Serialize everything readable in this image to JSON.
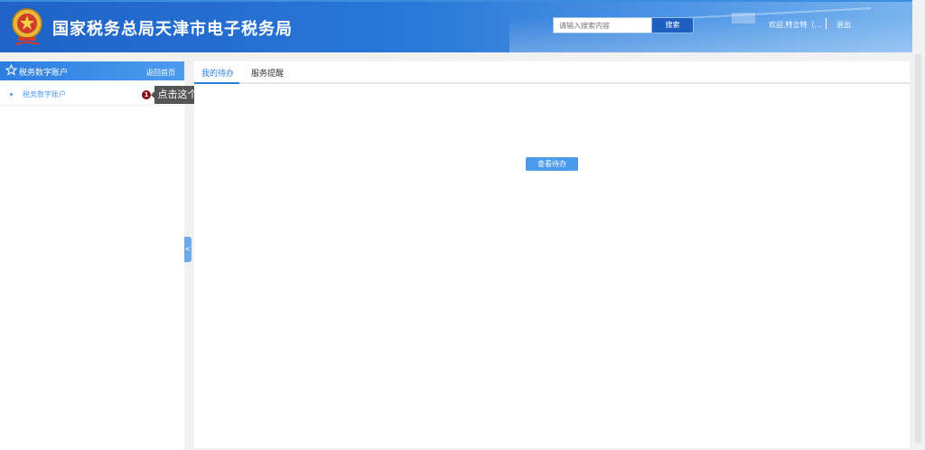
{
  "header": {
    "site_title": "国家税务总局天津市电子税务局",
    "search_placeholder": "请输入搜索内容",
    "search_button": "搜索",
    "welcome": "欢迎,特立特（...",
    "logout": "退出"
  },
  "sidebar": {
    "title": "税务数字账户",
    "back_home": "返回首页",
    "items": [
      {
        "label": "税务数字账户"
      }
    ]
  },
  "guide": {
    "step_number": "1",
    "tooltip": "点击这个"
  },
  "main": {
    "tabs": [
      {
        "label": "我的待办",
        "active": true
      },
      {
        "label": "服务提醒",
        "active": false
      }
    ],
    "view_todo_button": "查看待办"
  },
  "colors": {
    "header_blue": "#2a78d8",
    "accent": "#2d7fe0",
    "badge": "#8a0e0e"
  },
  "icons": {
    "emblem": "national-tax-emblem-icon",
    "star": "star-icon",
    "collapse": "chevron-left-icon"
  }
}
